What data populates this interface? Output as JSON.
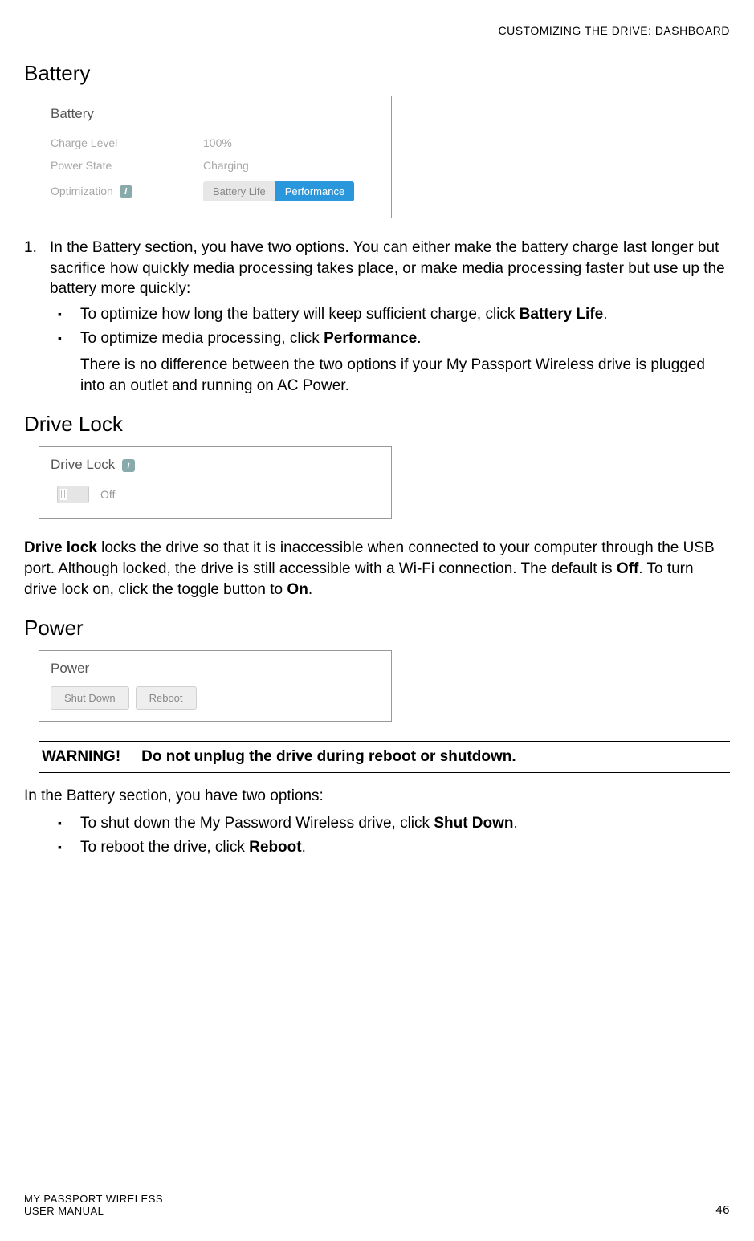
{
  "header": "CUSTOMIZING THE DRIVE: DASHBOARD",
  "sections": {
    "battery": {
      "heading": "Battery",
      "panel_title": "Battery",
      "charge_label": "Charge Level",
      "charge_value": "100%",
      "power_state_label": "Power State",
      "power_state_value": "Charging",
      "optimization_label": "Optimization",
      "battery_life_btn": "Battery Life",
      "performance_btn": "Performance",
      "step_num": "1.",
      "step_text": "In the Battery section, you have two options. You can either make the battery charge last longer but sacrifice how quickly media processing takes place, or make media processing faster but use up the battery more quickly:",
      "bullet1_pre": "To optimize how long the battery will keep sufficient charge, click ",
      "bullet1_bold": "Battery Life",
      "bullet1_post": ".",
      "bullet2_pre": "To optimize media processing, click ",
      "bullet2_bold": "Performance",
      "bullet2_post": ".",
      "note": "There is no difference between the two options if your My Passport Wireless drive is plugged into an outlet and running on AC Power."
    },
    "drivelock": {
      "heading": "Drive Lock",
      "panel_title": "Drive Lock",
      "toggle_state": "Off",
      "para_bold": "Drive lock",
      "para_pre": " locks the drive so that it is inaccessible when connected to your computer through the USB port. Although locked, the drive is still accessible with a Wi-Fi connection. The default is ",
      "para_off": "Off",
      "para_mid": ". To turn drive lock on, click the toggle button to ",
      "para_on": "On",
      "para_end": "."
    },
    "power": {
      "heading": "Power",
      "panel_title": "Power",
      "shutdown_btn": "Shut Down",
      "reboot_btn": "Reboot",
      "warning_label": "WARNING!",
      "warning_text": "Do not unplug the drive during reboot or shutdown.",
      "intro": "In the Battery section, you have two options:",
      "bullet1_pre": "To shut down the My Password Wireless drive, click ",
      "bullet1_bold": "Shut Down",
      "bullet1_post": ".",
      "bullet2_pre": "To reboot the drive, click ",
      "bullet2_bold": "Reboot",
      "bullet2_post": "."
    }
  },
  "footer": {
    "line1": "MY PASSPORT WIRELESS",
    "line2": "USER MANUAL",
    "page": "46"
  },
  "info_icon": "i",
  "bullet_char": "▪"
}
